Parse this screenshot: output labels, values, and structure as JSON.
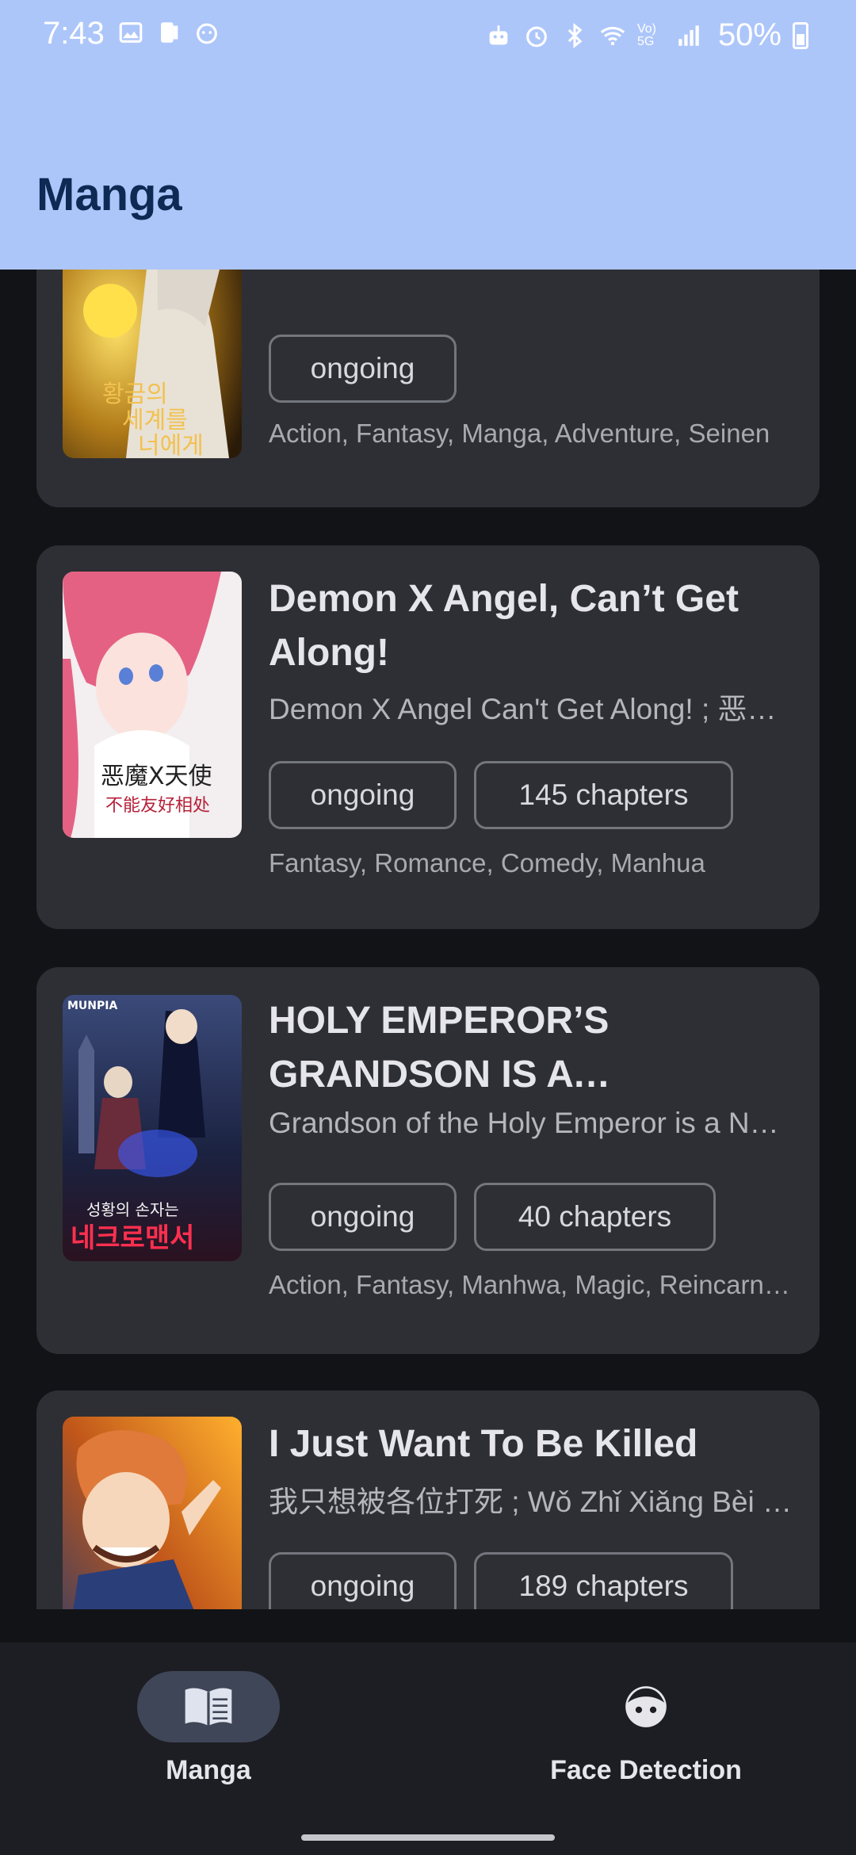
{
  "status_bar": {
    "time": "7:43",
    "battery_percent": "50%",
    "network_label": "Vo) 5G"
  },
  "app_bar": {
    "title": "Manga"
  },
  "cards": [
    {
      "title": "",
      "subtitle": "",
      "status": "ongoing",
      "chapters": "",
      "genres": "Action, Fantasy, Manga, Adventure, Seinen",
      "cover_text": [
        "황금의",
        "세계를",
        "너에게"
      ]
    },
    {
      "title": " Demon X Angel, Can’t Get Along!",
      "subtitle": "Demon X Angel Can't Get Along! ; 恶魔X天使 不能友好相处",
      "status": "ongoing",
      "chapters": "145 chapters",
      "genres": "Fantasy, Romance, Comedy, Manhua",
      "cover_text": [
        "恶魔X天使",
        "不能友好相处"
      ]
    },
    {
      "title": " HOLY EMPEROR’S GRANDSON IS A NECROMANCER",
      "subtitle": "Grandson of the Holy Emperor is a Necromancer",
      "status": "ongoing",
      "chapters": "40 chapters",
      "genres": "Action, Fantasy, Manhwa, Magic, Reincarnation",
      "cover_text": [
        "MUNPIA",
        "성황의 손자는",
        "네크로맨서"
      ]
    },
    {
      "title": " I Just Want To Be Killed",
      "subtitle": "我只想被各位打死 ; Wǒ Zhǐ Xiǎng Bèi Gèwèi Dǎ Sǐ",
      "status": "ongoing",
      "chapters": "189 chapters",
      "genres": "",
      "cover_text": []
    }
  ],
  "bottom_nav": {
    "items": [
      {
        "label": "Manga",
        "icon": "book-icon",
        "active": true
      },
      {
        "label": "Face Detection",
        "icon": "face-icon",
        "active": false
      }
    ]
  },
  "colors": {
    "app_bar": "#adc6fa",
    "background": "#111317",
    "card": "#2e2f34",
    "nav_bar": "#1d1e23",
    "nav_active_pill": "#3f4658"
  }
}
